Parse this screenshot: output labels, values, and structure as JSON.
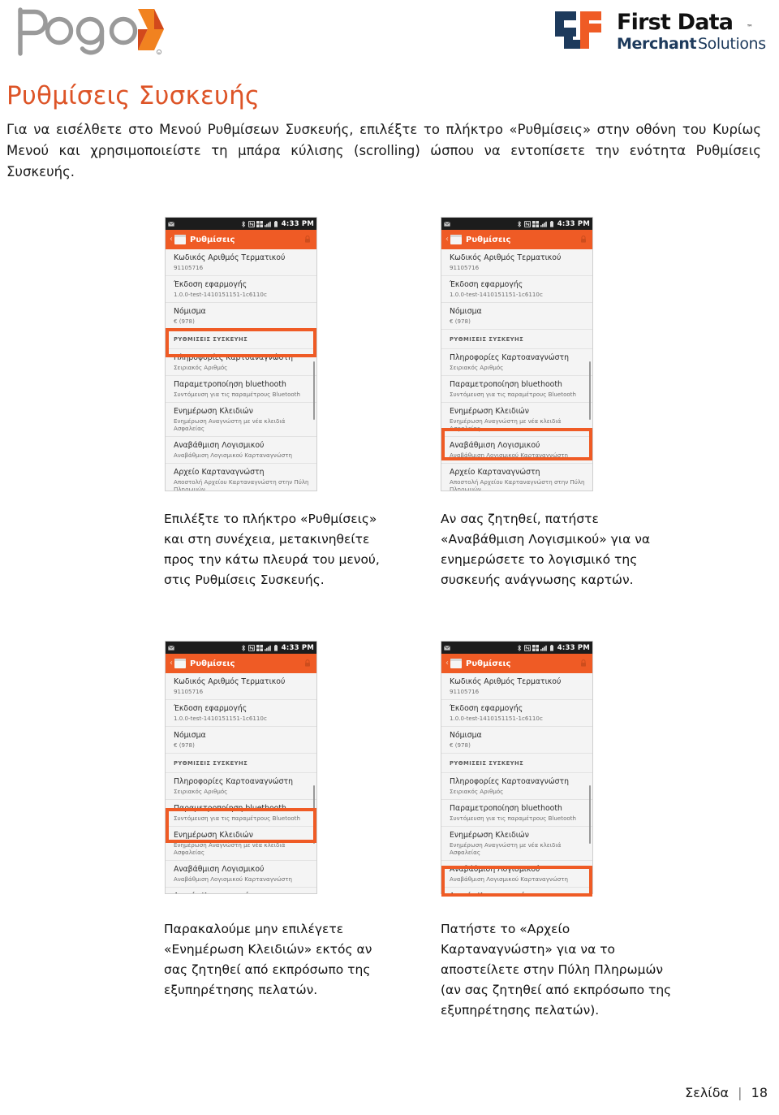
{
  "branding": {
    "pogo_logo_alt": "Pogo",
    "firstdata_logo_line1": "First Data",
    "firstdata_logo_line2_bold": "Merchant",
    "firstdata_logo_line2_light": "Solutions",
    "firstdata_tm": "TM",
    "pogo_gray": "#9a9a9a",
    "pogo_orange": "#ef7622",
    "pogo_orange_dark": "#d2491c",
    "fd_navy": "#1d3a5c",
    "fd_orange": "#ef5b25"
  },
  "document": {
    "title": "Ρυθμίσεις Συσκευής",
    "title_color": "#dd5427",
    "intro": "Για να εισέλθετε στο Μενού Ρυθμίσεων Συσκευής, επιλέξτε το πλήκτρο «Ρυθμίσεις» στην οθόνη του Κυρίως Μενού και χρησιμοποιείστε τη μπάρα κύλισης (scrolling) ώσπου να εντοπίσετε την ενότητα Ρυθμίσεις Συσκευής.",
    "footer_label": "Σελίδα",
    "footer_separator": "|",
    "footer_page": "18"
  },
  "phone_ui": {
    "statusbar": {
      "time": "4:33 PM",
      "icons": [
        "mail-icon",
        "bluetooth-icon",
        "nfc-icon",
        "network-icon",
        "signal-icon",
        "battery-icon"
      ]
    },
    "appbar": {
      "back_glyph": "‹",
      "title": "Ρυθμίσεις",
      "icon": "settings-app-icon",
      "lock_icon": "lock-icon",
      "background": "#ef5b25"
    },
    "rows": [
      {
        "title": "Κωδικός Αριθμός Τερματικού",
        "subtitle": "91105716",
        "type": "item"
      },
      {
        "title": "Έκδοση εφαρμογής",
        "subtitle": "1.0.0-test-1410151151-1c6110c",
        "type": "item"
      },
      {
        "title": "Νόμισμα",
        "subtitle": "€ (978)",
        "type": "item"
      },
      {
        "title": "ΡΥΘΜΙΣΕΙΣ ΣΥΣΚΕΥΗΣ",
        "subtitle": "",
        "type": "section"
      },
      {
        "title": "Πληροφορίες Καρτοαναγνώστη",
        "subtitle": "Σειριακός Αριθμός",
        "type": "item"
      },
      {
        "title": "Παραμετροποίηση bluethooth",
        "subtitle": "Συντόμευση για τις παραμέτρους Bluetooth",
        "type": "item"
      },
      {
        "title": "Ενημέρωση Κλειδιών",
        "subtitle": "Ενημέρωση Αναγνώστη με νέα κλειδιά Ασφαλείας",
        "type": "item"
      },
      {
        "title": "Αναβάθμιση Λογισμικού",
        "subtitle": "Αναβάθμιση Λογισμικού Καρταναγνώστη",
        "type": "item"
      },
      {
        "title": "Αρχείο Καρταναγνώστη",
        "subtitle": "Αποστολή Αρχείου Καρταναγνώστη στην Πύλη Πληρωμών",
        "type": "item"
      }
    ]
  },
  "screenshots": [
    {
      "name": "screenshot-settings-device-section",
      "highlight_target": "ΡΥΘΜΙΣΕΙΣ ΣΥΣΚΕΥΗΣ",
      "caption": "Επιλέξτε το πλήκτρο «Ρυθμίσεις» και στη συνέχεια, μετακινηθείτε προς την κάτω πλευρά του μενού, στις Ρυθμίσεις Συσκευής."
    },
    {
      "name": "screenshot-software-upgrade",
      "highlight_target": "Αναβάθμιση Λογισμικού",
      "caption": "Αν σας ζητηθεί, πατήστε «Αναβάθμιση Λογισμικού» για να ενημερώσετε το λογισμικό της συσκευής ανάγνωσης καρτών."
    },
    {
      "name": "screenshot-key-update",
      "highlight_target": "Ενημέρωση Κλειδιών",
      "caption": "Παρακαλούμε μην επιλέγετε «Ενημέρωση Κλειδιών» εκτός αν σας ζητηθεί από εκπρόσωπο της εξυπηρέτησης πελατών."
    },
    {
      "name": "screenshot-reader-file",
      "highlight_target": "Αρχείο Καρταναγνώστη",
      "caption": "Πατήστε το «Αρχείο Καρταναγνώστη» για να το αποστείλετε στην Πύλη Πληρωμών (αν σας ζητηθεί από εκπρόσωπο της εξυπηρέτησης πελατών)."
    }
  ]
}
